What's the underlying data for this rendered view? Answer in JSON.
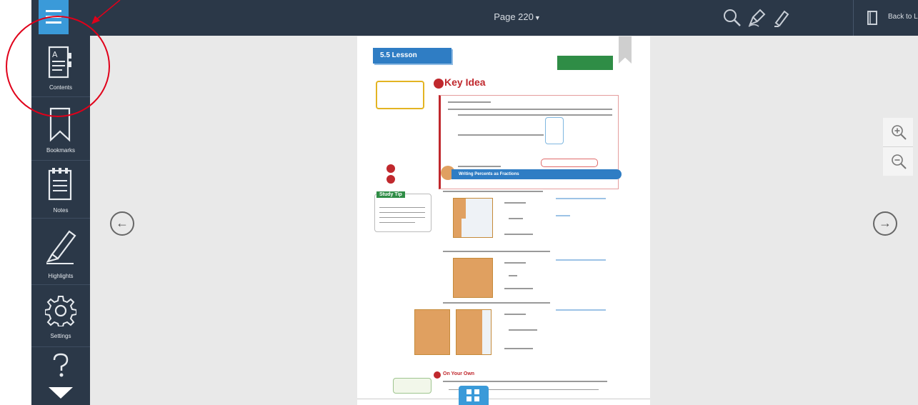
{
  "topbar": {
    "page_label": "Page 220",
    "back_label": "Back to Library",
    "tools": [
      "search-icon",
      "annotate-icon",
      "highlight-pen-icon"
    ]
  },
  "sidebar": {
    "items": [
      {
        "label": "Contents",
        "icon": "contents-icon"
      },
      {
        "label": "Bookmarks",
        "icon": "bookmark-icon"
      },
      {
        "label": "Notes",
        "icon": "notes-icon"
      },
      {
        "label": "Highlights",
        "icon": "highlighter-icon"
      },
      {
        "label": "Settings",
        "icon": "gear-icon"
      },
      {
        "label": "",
        "icon": "help-icon"
      }
    ]
  },
  "page": {
    "lesson": "5.5  Lesson",
    "key_idea": "Key Idea",
    "example_heading": "Writing Percents as Fractions",
    "study_tip": "Study Tip",
    "on_your_own": "On Your Own"
  },
  "colors": {
    "toolbar": "#2b3848",
    "accent": "#3a9ad9",
    "background": "#e9e9e9",
    "annotation": "#e0001a"
  }
}
